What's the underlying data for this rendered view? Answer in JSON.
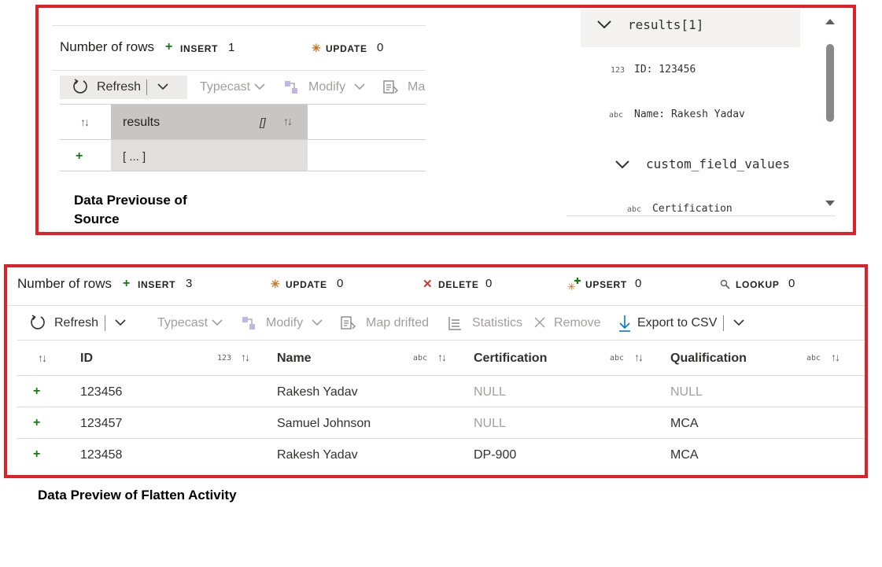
{
  "source_preview": {
    "stats": {
      "rows_label": "Number of rows",
      "insert_label": "INSERT",
      "insert_count": "1",
      "update_label": "UPDATE",
      "update_count": "0"
    },
    "toolbar": {
      "refresh": "Refresh",
      "typecast": "Typecast",
      "modify": "Modify",
      "map_drifted_partial": "Ma"
    },
    "grid": {
      "column": "results",
      "column_type": "[]",
      "row_value": "[ ... ]"
    },
    "caption_line1": "Data Previouse of",
    "caption_line2": "Source",
    "tree": {
      "node": "results[1]",
      "id_type": "123",
      "id_text": "ID: 123456",
      "name_type": "abc",
      "name_text": "Name: Rakesh Yadav",
      "child_node": "custom_field_values",
      "cert_type": "abc",
      "cert_text": "Certification"
    }
  },
  "flatten_preview": {
    "stats": {
      "rows_label": "Number of rows",
      "insert_label": "INSERT",
      "insert_count": "3",
      "update_label": "UPDATE",
      "update_count": "0",
      "delete_label": "DELETE",
      "delete_count": "0",
      "upsert_label": "UPSERT",
      "upsert_count": "0",
      "lookup_label": "LOOKUP",
      "lookup_count": "0"
    },
    "toolbar": {
      "refresh": "Refresh",
      "typecast": "Typecast",
      "modify": "Modify",
      "map_drifted": "Map drifted",
      "statistics": "Statistics",
      "remove": "Remove",
      "export_csv": "Export to CSV"
    },
    "columns": [
      {
        "name": "ID",
        "type": "123"
      },
      {
        "name": "Name",
        "type": "abc"
      },
      {
        "name": "Certification",
        "type": "abc"
      },
      {
        "name": "Qualification",
        "type": "abc"
      }
    ],
    "rows": [
      {
        "id": "123456",
        "name": "Rakesh Yadav",
        "certification": "NULL",
        "qualification": "NULL"
      },
      {
        "id": "123457",
        "name": "Samuel Johnson",
        "certification": "NULL",
        "qualification": "MCA"
      },
      {
        "id": "123458",
        "name": "Rakesh Yadav",
        "certification": "DP-900",
        "qualification": "MCA"
      }
    ],
    "caption": "Data Preview of Flatten Activity"
  },
  "colors": {
    "frame_red": "#e01f26",
    "insert_green": "#107c10",
    "update_orange": "#c87521",
    "delete_red": "#d13438",
    "link_blue": "#0078d4",
    "disabled_gray": "#a19f9d"
  }
}
